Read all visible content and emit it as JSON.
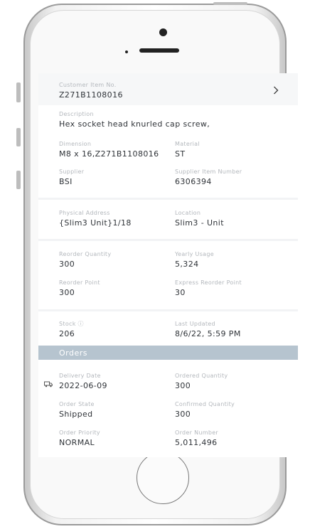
{
  "item": {
    "customer_item_no": {
      "label": "Customer Item No.",
      "value": "Z271B1108016"
    },
    "description": {
      "label": "Description",
      "value": "Hex socket head knurled cap screw,"
    },
    "dimension": {
      "label": "Dimension",
      "value": "M8 x 16,Z271B1108016"
    },
    "material": {
      "label": "Material",
      "value": "ST"
    },
    "supplier": {
      "label": "Supplier",
      "value": "BSI"
    },
    "supplier_item_number": {
      "label": "Supplier Item Number",
      "value": "6306394"
    }
  },
  "location": {
    "physical_address": {
      "label": "Physical Address",
      "value": "{Slim3 Unit}1/18"
    },
    "location": {
      "label": "Location",
      "value": "Slim3 - Unit"
    }
  },
  "inventory": {
    "reorder_quantity": {
      "label": "Reorder Quantity",
      "value": "300"
    },
    "yearly_usage": {
      "label": "Yearly Usage",
      "value": "5,324"
    },
    "reorder_point": {
      "label": "Reorder Point",
      "value": "300"
    },
    "express_reorder_point": {
      "label": "Express Reorder Point",
      "value": "30"
    }
  },
  "stock": {
    "stock": {
      "label": "Stock ⓘ",
      "value": "206"
    },
    "last_updated": {
      "label": "Last Updated",
      "value": "8/6/22, 5:59 PM"
    }
  },
  "orders": {
    "title": "Orders",
    "delivery_date": {
      "label": "Delivery Date",
      "value": "2022-06-09"
    },
    "ordered_quantity": {
      "label": "Ordered Quantity",
      "value": "300"
    },
    "order_state": {
      "label": "Order State",
      "value": "Shipped"
    },
    "confirmed_quantity": {
      "label": "Confirmed Quantity",
      "value": "300"
    },
    "order_priority": {
      "label": "Order Priority",
      "value": "NORMAL"
    },
    "order_number": {
      "label": "Order Number",
      "value": "5,011,496"
    }
  },
  "icons": {
    "chevron": "chevron-right-icon",
    "truck": "truck-icon"
  },
  "colors": {
    "orders_bar": "#b6c4cf",
    "label": "#b3b7bc",
    "value": "#2f3338"
  }
}
